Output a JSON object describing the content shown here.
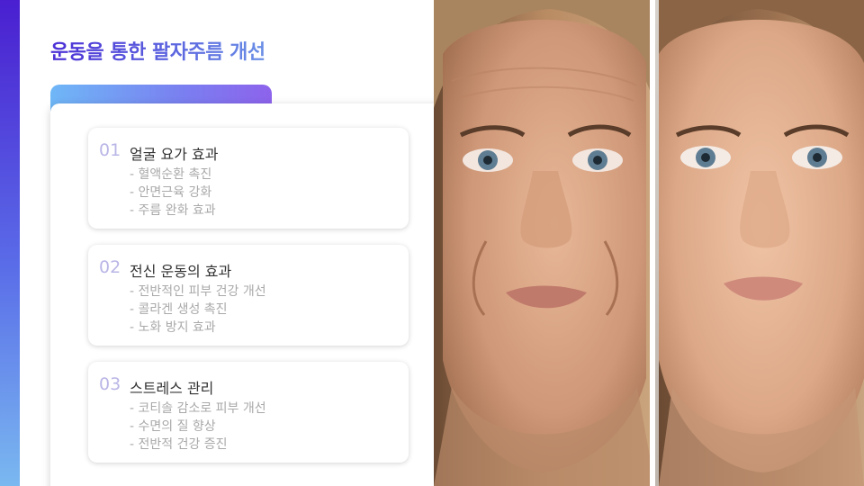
{
  "slide": {
    "title": "운동을 통한 팔자주름 개선",
    "accent_colors": [
      "#4b2fd6",
      "#6fb7f7"
    ]
  },
  "items": [
    {
      "number": "01",
      "title": "얼굴 요가 효과",
      "lines": [
        "- 혈액순환 촉진",
        "- 안면근육 강화",
        "- 주름 완화 효과"
      ]
    },
    {
      "number": "02",
      "title": "전신 운동의 효과",
      "lines": [
        "- 전반적인 피부 건강 개선",
        "- 콜라겐 생성 촉진",
        "- 노화 방지 효과"
      ]
    },
    {
      "number": "03",
      "title": "스트레스 관리",
      "lines": [
        "- 코티솔 감소로 피부 개선",
        "- 수면의 질 향상",
        "- 전반적 건강 증진"
      ]
    }
  ],
  "photos": {
    "before": "face-before-image",
    "after": "face-after-image"
  }
}
